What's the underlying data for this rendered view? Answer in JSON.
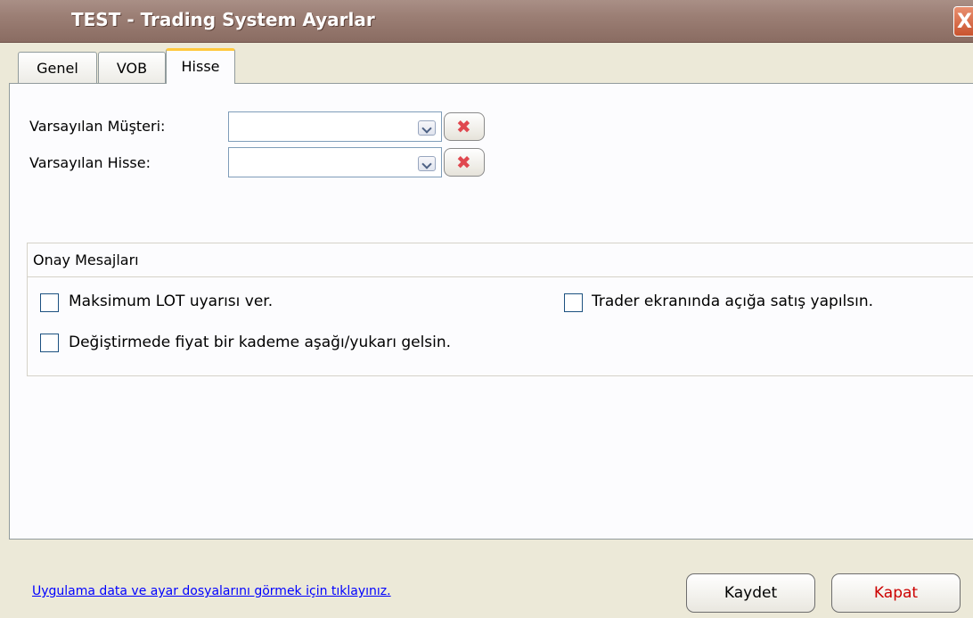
{
  "window": {
    "title": "TEST - Trading System Ayarlar",
    "close_glyph": "X"
  },
  "tabs": [
    {
      "label": "Genel",
      "active": false
    },
    {
      "label": "VOB",
      "active": false
    },
    {
      "label": "Hisse",
      "active": true
    }
  ],
  "form": {
    "customer_label": "Varsayılan Müşteri:",
    "customer_value": "",
    "stock_label": "Varsayılan Hisse:",
    "stock_value": "",
    "clear_glyph": "✖"
  },
  "confirmations": {
    "title": "Onay Mesajları",
    "options": [
      {
        "label": "Maksimum LOT uyarısı ver.",
        "checked": false
      },
      {
        "label": "Değiştirmede fiyat bir kademe aşağı/yukarı gelsin.",
        "checked": false
      },
      {
        "label": "Trader ekranında açığa satış yapılsın.",
        "checked": false
      }
    ]
  },
  "footer": {
    "link_text": "Uygulama data ve ayar dosyalarını görmek için tıklayınız.",
    "save_label": "Kaydet",
    "close_label": "Kapat"
  },
  "colors": {
    "titlebar": "#9b7e74",
    "link": "#0000ff",
    "close_text": "#cc0000",
    "clear_icon": "#e0484f"
  }
}
